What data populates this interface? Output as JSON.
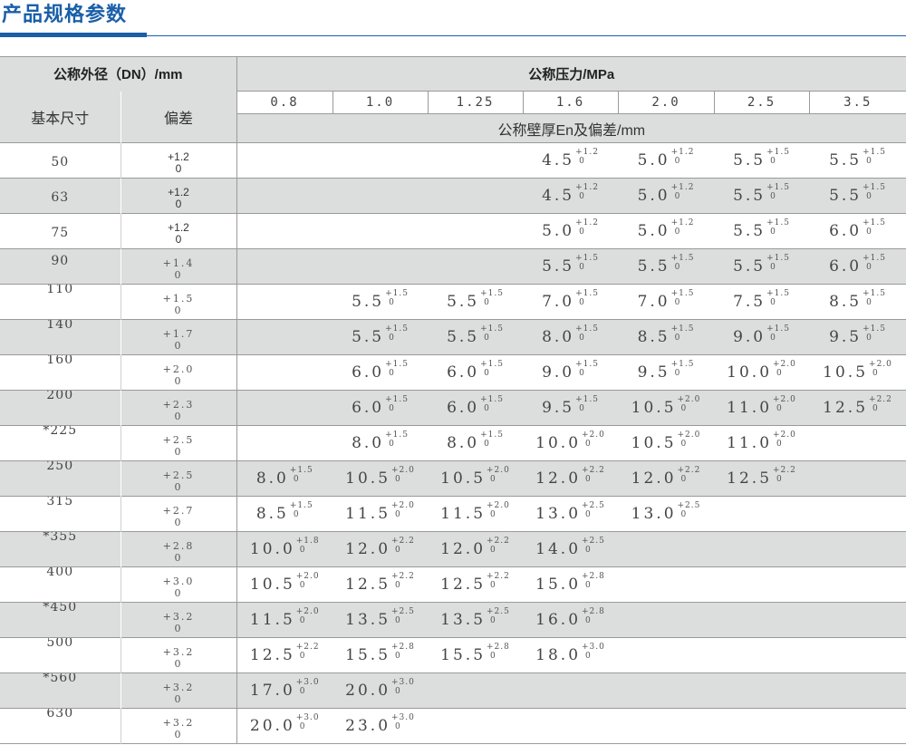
{
  "title": "产品规格参数",
  "colors": {
    "accent": "#1a5fa8",
    "header_fill": "#dcdddd",
    "rule": "#9a9a9a"
  },
  "header": {
    "dn_label": "公称外径（DN）/mm",
    "pressure_label": "公称压力/MPa",
    "basic_size": "基本尺寸",
    "deviation": "偏差",
    "wall_label": "公称壁厚En及偏差/mm",
    "pressures": [
      "0.8",
      "1.0",
      "1.25",
      "1.6",
      "2.0",
      "2.5",
      "3.5"
    ]
  },
  "rows": [
    {
      "dn": "50",
      "dev_plus": "+1.2",
      "dev_minus": "0",
      "dev_serif": false,
      "cells": [
        null,
        null,
        null,
        [
          "4.5",
          "+1.2",
          "0"
        ],
        [
          "5.0",
          "+1.2",
          "0"
        ],
        [
          "5.5",
          "+1.5",
          "0"
        ],
        [
          "5.5",
          "+1.5",
          "0"
        ]
      ]
    },
    {
      "dn": "63",
      "dev_plus": "+1.2",
      "dev_minus": "0",
      "dev_serif": false,
      "cells": [
        null,
        null,
        null,
        [
          "4.5",
          "+1.2",
          "0"
        ],
        [
          "5.0",
          "+1.2",
          "0"
        ],
        [
          "5.5",
          "+1.5",
          "0"
        ],
        [
          "5.5",
          "+1.5",
          "0"
        ]
      ]
    },
    {
      "dn": "75",
      "dev_plus": "+1.2",
      "dev_minus": "0",
      "dev_serif": false,
      "cells": [
        null,
        null,
        null,
        [
          "5.0",
          "+1.2",
          "0"
        ],
        [
          "5.0",
          "+1.2",
          "0"
        ],
        [
          "5.5",
          "+1.5",
          "0"
        ],
        [
          "6.0",
          "+1.5",
          "0"
        ]
      ]
    },
    {
      "dn": "90",
      "dev_plus": "+1.4",
      "dev_minus": "0",
      "dev_serif": true,
      "cells": [
        null,
        null,
        null,
        [
          "5.5",
          "+1.5",
          "0"
        ],
        [
          "5.5",
          "+1.5",
          "0"
        ],
        [
          "5.5",
          "+1.5",
          "0"
        ],
        [
          "6.0",
          "+1.5",
          "0"
        ]
      ]
    },
    {
      "dn": "110",
      "dev_plus": "+1.5",
      "dev_minus": "0",
      "dev_serif": true,
      "cells": [
        null,
        [
          "5.5",
          "+1.5",
          "0"
        ],
        [
          "5.5",
          "+1.5",
          "0"
        ],
        [
          "7.0",
          "+1.5",
          "0"
        ],
        [
          "7.0",
          "+1.5",
          "0"
        ],
        [
          "7.5",
          "+1.5",
          "0"
        ],
        [
          "8.5",
          "+1.5",
          "0"
        ]
      ]
    },
    {
      "dn": "140",
      "dev_plus": "+1.7",
      "dev_minus": "0",
      "dev_serif": true,
      "cells": [
        null,
        [
          "5.5",
          "+1.5",
          "0"
        ],
        [
          "5.5",
          "+1.5",
          "0"
        ],
        [
          "8.0",
          "+1.5",
          "0"
        ],
        [
          "8.5",
          "+1.5",
          "0"
        ],
        [
          "9.0",
          "+1.5",
          "0"
        ],
        [
          "9.5",
          "+1.5",
          "0"
        ]
      ]
    },
    {
      "dn": "160",
      "dev_plus": "+2.0",
      "dev_minus": "0",
      "dev_serif": true,
      "cells": [
        null,
        [
          "6.0",
          "+1.5",
          "0"
        ],
        [
          "6.0",
          "+1.5",
          "0"
        ],
        [
          "9.0",
          "+1.5",
          "0"
        ],
        [
          "9.5",
          "+1.5",
          "0"
        ],
        [
          "10.0",
          "+2.0",
          "0"
        ],
        [
          "10.5",
          "+2.0",
          "0"
        ]
      ]
    },
    {
      "dn": "200",
      "dev_plus": "+2.3",
      "dev_minus": "0",
      "dev_serif": true,
      "cells": [
        null,
        [
          "6.0",
          "+1.5",
          "0"
        ],
        [
          "6.0",
          "+1.5",
          "0"
        ],
        [
          "9.5",
          "+1.5",
          "0"
        ],
        [
          "10.5",
          "+2.0",
          "0"
        ],
        [
          "11.0",
          "+2.0",
          "0"
        ],
        [
          "12.5",
          "+2.2",
          "0"
        ]
      ]
    },
    {
      "dn": "*225",
      "dev_plus": "+2.5",
      "dev_minus": "0",
      "dev_serif": true,
      "cells": [
        null,
        [
          "8.0",
          "+1.5",
          "0"
        ],
        [
          "8.0",
          "+1.5",
          "0"
        ],
        [
          "10.0",
          "+2.0",
          "0"
        ],
        [
          "10.5",
          "+2.0",
          "0"
        ],
        [
          "11.0",
          "+2.0",
          "0"
        ],
        null
      ]
    },
    {
      "dn": "250",
      "dev_plus": "+2.5",
      "dev_minus": "0",
      "dev_serif": true,
      "cells": [
        [
          "8.0",
          "+1.5",
          "0"
        ],
        [
          "10.5",
          "+2.0",
          "0"
        ],
        [
          "10.5",
          "+2.0",
          "0"
        ],
        [
          "12.0",
          "+2.2",
          "0"
        ],
        [
          "12.0",
          "+2.2",
          "0"
        ],
        [
          "12.5",
          "+2.2",
          "0"
        ],
        null
      ]
    },
    {
      "dn": "315",
      "dev_plus": "+2.7",
      "dev_minus": "0",
      "dev_serif": true,
      "cells": [
        [
          "8.5",
          "+1.5",
          "0"
        ],
        [
          "11.5",
          "+2.0",
          "0"
        ],
        [
          "11.5",
          "+2.0",
          "0"
        ],
        [
          "13.0",
          "+2.5",
          "0"
        ],
        [
          "13.0",
          "+2.5",
          "0"
        ],
        null,
        null
      ]
    },
    {
      "dn": "*355",
      "dev_plus": "+2.8",
      "dev_minus": "0",
      "dev_serif": true,
      "cells": [
        [
          "10.0",
          "+1.8",
          "0"
        ],
        [
          "12.0",
          "+2.2",
          "0"
        ],
        [
          "12.0",
          "+2.2",
          "0"
        ],
        [
          "14.0",
          "+2.5",
          "0"
        ],
        null,
        null,
        null
      ]
    },
    {
      "dn": "400",
      "dev_plus": "+3.0",
      "dev_minus": "0",
      "dev_serif": true,
      "cells": [
        [
          "10.5",
          "+2.0",
          "0"
        ],
        [
          "12.5",
          "+2.2",
          "0"
        ],
        [
          "12.5",
          "+2.2",
          "0"
        ],
        [
          "15.0",
          "+2.8",
          "0"
        ],
        null,
        null,
        null
      ]
    },
    {
      "dn": "*450",
      "dev_plus": "+3.2",
      "dev_minus": "0",
      "dev_serif": true,
      "cells": [
        [
          "11.5",
          "+2.0",
          "0"
        ],
        [
          "13.5",
          "+2.5",
          "0"
        ],
        [
          "13.5",
          "+2.5",
          "0"
        ],
        [
          "16.0",
          "+2.8",
          "0"
        ],
        null,
        null,
        null
      ]
    },
    {
      "dn": "500",
      "dev_plus": "+3.2",
      "dev_minus": "0",
      "dev_serif": true,
      "cells": [
        [
          "12.5",
          "+2.2",
          "0"
        ],
        [
          "15.5",
          "+2.8",
          "0"
        ],
        [
          "15.5",
          "+2.8",
          "0"
        ],
        [
          "18.0",
          "+3.0",
          "0"
        ],
        null,
        null,
        null
      ]
    },
    {
      "dn": "*560",
      "dev_plus": "+3.2",
      "dev_minus": "0",
      "dev_serif": true,
      "cells": [
        [
          "17.0",
          "+3.0",
          "0"
        ],
        [
          "20.0",
          "+3.0",
          "0"
        ],
        null,
        null,
        null,
        null,
        null
      ]
    },
    {
      "dn": "630",
      "dev_plus": "+3.2",
      "dev_minus": "0",
      "dev_serif": true,
      "cells": [
        [
          "20.0",
          "+3.0",
          "0"
        ],
        [
          "23.0",
          "+3.0",
          "0"
        ],
        null,
        null,
        null,
        null,
        null
      ]
    }
  ]
}
